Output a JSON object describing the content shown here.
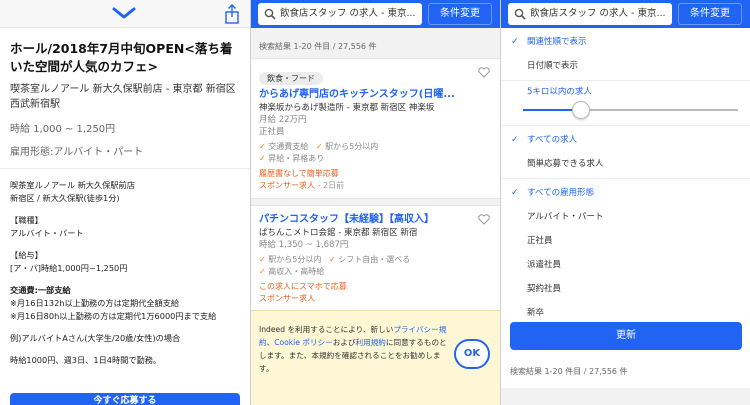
{
  "panel1": {
    "icons": [
      "chevron-down-icon",
      "share-icon"
    ],
    "job_title": "ホール/2018年7月中旬OPEN<落ち着いた空間が人気のカフェ>",
    "company": "喫茶室ルノアール 新大久保駅前店 - 東京都 新宿区 西武新宿駅",
    "salary": "時給 1,000 ~ 1,250円",
    "employment_type": "雇用形態:アルバイト・パート",
    "desc_lines": [
      "喫茶室ルノアール 新大久保駅前店",
      "新宿区 / 新大久保駅(徒歩1分)",
      "",
      "【職種】",
      "アルバイト・パート",
      "",
      "【給与】",
      "[ア・パ]時給1,000円~1,250円",
      "",
      "交通費:一部支給",
      "※月16日132h以上勤務の方は定期代全額支給",
      "※月16日80h以上勤務の方は定期代1万6000円まで支給",
      "",
      "例)アルバイトAさん(大学生/20歳/女性)の場合",
      "",
      "時給1000円、週3日、1日4時間で勤務。"
    ],
    "apply_label": "今すぐ応募する"
  },
  "panel2": {
    "search_text": "飲食店スタッフ の求人 - 東京...",
    "condition_button": "条件変更",
    "result_count": "検索結果 1-20 件目 / 27,556 件",
    "cards": [
      {
        "tag": "飲食・フード",
        "title": "からあげ専門店のキッチンスタッフ(日曜...",
        "company": "神楽坂からあげ製造所 - 東京都 新宿区 神楽坂",
        "salary": "月給 22万円",
        "type": "正社員",
        "features": [
          "交通費支給",
          "駅から5分以内",
          "昇給・昇格あり"
        ],
        "notice": "履歴書なしで簡単応募",
        "sponsor": "スポンサー求人",
        "ago": "2日前"
      },
      {
        "title": "パチンコスタッフ【未経験】【高収入】",
        "company": "ぱちんこメトロ会館 - 東京都 新宿区 新宿",
        "salary": "時給 1,350 ~ 1,687円",
        "features": [
          "駅から5分以内",
          "シフト自由・選べる",
          "高収入・高時給"
        ],
        "notice": "この求人にスマホで応募",
        "sponsor": "スポンサー求人"
      }
    ],
    "cookie": {
      "text_a": "Indeed を利用することにより、新しい",
      "link_privacy": "プライバシー規約",
      "text_b": "、",
      "link_cookie": "Cookie ポリシー",
      "text_c": "およ",
      "text_d": "び",
      "link_terms": "利用規約",
      "text_e": "に同意するものとします。また、本規約を確認されることをお勧めします。",
      "ok": "OK"
    }
  },
  "panel3": {
    "search_text": "飲食店スタッフ の求人 - 東京...",
    "condition_button": "条件変更",
    "sort_options": [
      {
        "label": "関連性順で表示",
        "selected": true
      },
      {
        "label": "日付順で表示",
        "selected": false
      }
    ],
    "radius_label": "5キロ以内の求人",
    "radius_slider_fraction": 0.27,
    "apply_options": [
      {
        "label": "すべての求人",
        "selected": true
      },
      {
        "label": "簡単応募できる求人",
        "selected": false
      }
    ],
    "employment_options": [
      {
        "label": "すべての雇用形態",
        "selected": true
      },
      {
        "label": "アルバイト・パート",
        "selected": false
      },
      {
        "label": "正社員",
        "selected": false
      },
      {
        "label": "派遣社員",
        "selected": false
      },
      {
        "label": "契約社員",
        "selected": false
      },
      {
        "label": "新卒",
        "selected": false
      }
    ],
    "update_button": "更新",
    "result_count": "検索結果 1-20 件目 / 27,556 件"
  },
  "colors": {
    "brand_blue": "#2164f3",
    "accent_orange": "#e8601b",
    "cookie_bg": "#fdf7d6"
  }
}
